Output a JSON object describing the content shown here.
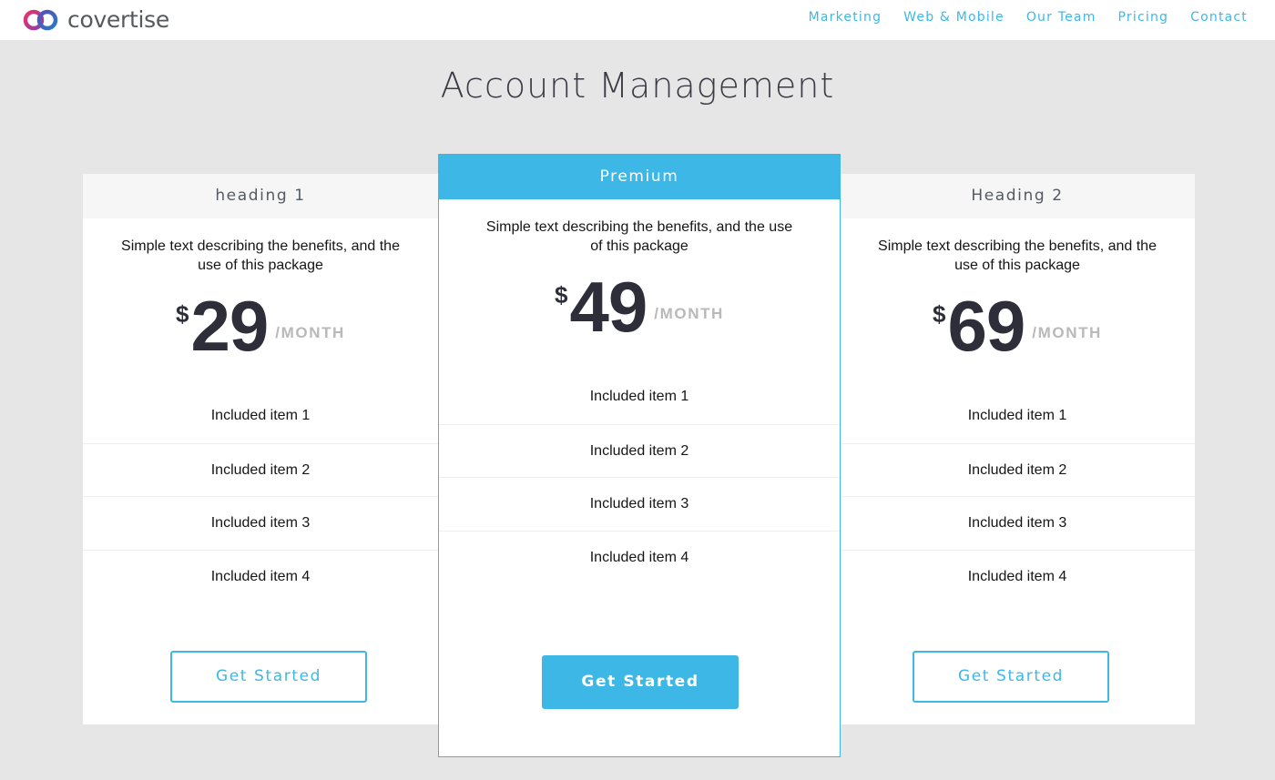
{
  "brand": {
    "name": "covertise",
    "colors": {
      "accent": "#3db8e6",
      "logo_pink": "#e8336d",
      "logo_blue": "#2a78c5",
      "background": "#e6e6e6"
    }
  },
  "nav": {
    "items": [
      {
        "label": "Marketing"
      },
      {
        "label": "Web & Mobile"
      },
      {
        "label": "Our Team"
      },
      {
        "label": "Pricing"
      },
      {
        "label": "Contact"
      }
    ]
  },
  "page": {
    "title": "Account Management"
  },
  "plans": [
    {
      "heading": "heading 1",
      "description": "Simple text describing the benefits, and the use of this package",
      "currency": "$",
      "price": "29",
      "period": "/MONTH",
      "items": [
        "Included item 1",
        "Included item 2",
        "Included item 3",
        "Included item 4"
      ],
      "cta": "Get Started"
    },
    {
      "heading": "Premium",
      "description": "Simple text describing the benefits, and the use of this package",
      "currency": "$",
      "price": "49",
      "period": "/MONTH",
      "items": [
        "Included item 1",
        "Included item 2",
        "Included item 3",
        "Included item 4"
      ],
      "cta": "Get Started",
      "featured": true
    },
    {
      "heading": "Heading 2",
      "description": "Simple text describing the benefits, and the use of this package",
      "currency": "$",
      "price": "69",
      "period": "/MONTH",
      "items": [
        "Included item 1",
        "Included item 2",
        "Included item 3",
        "Included item 4"
      ],
      "cta": "Get Started"
    }
  ],
  "icons": {
    "logo": "linked-rings-logo-icon"
  }
}
